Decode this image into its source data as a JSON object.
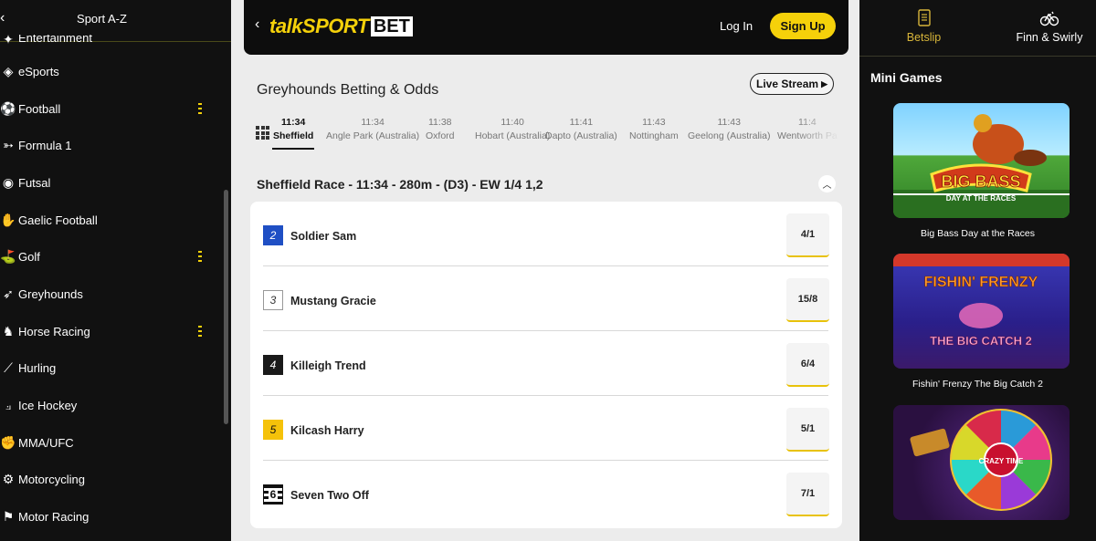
{
  "sidebar": {
    "title": "Sport A-Z",
    "items": [
      {
        "label": "Entertainment",
        "icon": "entertainment-icon",
        "dots": false
      },
      {
        "label": "eSports",
        "icon": "esports-icon",
        "dots": false
      },
      {
        "label": "Football",
        "icon": "football-icon",
        "dots": true
      },
      {
        "label": "Formula 1",
        "icon": "formula1-icon",
        "dots": false
      },
      {
        "label": "Futsal",
        "icon": "futsal-icon",
        "dots": false
      },
      {
        "label": "Gaelic Football",
        "icon": "gaelic-football-icon",
        "dots": false
      },
      {
        "label": "Golf",
        "icon": "golf-icon",
        "dots": true
      },
      {
        "label": "Greyhounds",
        "icon": "greyhound-icon",
        "dots": false
      },
      {
        "label": "Horse Racing",
        "icon": "horse-racing-icon",
        "dots": true
      },
      {
        "label": "Hurling",
        "icon": "hurling-icon",
        "dots": false
      },
      {
        "label": "Ice Hockey",
        "icon": "ice-hockey-icon",
        "dots": false
      },
      {
        "label": "MMA/UFC",
        "icon": "mma-glove-icon",
        "dots": false
      },
      {
        "label": "Motorcycling",
        "icon": "motorcycle-icon",
        "dots": false
      },
      {
        "label": "Motor Racing",
        "icon": "chequered-flag-icon",
        "dots": false
      }
    ]
  },
  "header": {
    "logo_main": "talkSPORT",
    "logo_bet": "BET",
    "login_label": "Log In",
    "signup_label": "Sign Up"
  },
  "main": {
    "page_title": "Greyhounds Betting & Odds",
    "live_stream_label": "Live Stream",
    "race_tabs": [
      {
        "time": "11:34",
        "venue": "Sheffield",
        "active": true
      },
      {
        "time": "11:34",
        "venue": "Angle Park (Australia)",
        "active": false
      },
      {
        "time": "11:38",
        "venue": "Oxford",
        "active": false
      },
      {
        "time": "11:40",
        "venue": "Hobart (Australia)",
        "active": false
      },
      {
        "time": "11:41",
        "venue": "Dapto (Australia)",
        "active": false
      },
      {
        "time": "11:43",
        "venue": "Nottingham",
        "active": false
      },
      {
        "time": "11:43",
        "venue": "Geelong (Australia)",
        "active": false
      },
      {
        "time": "11:4",
        "venue": "Wentworth Pa",
        "active": false
      }
    ],
    "race_heading": "Sheffield Race - 11:34 - 280m - (D3) - EW 1/4 1,2",
    "runners": [
      {
        "trap": "2",
        "name": "Soldier Sam",
        "odds": "4/1"
      },
      {
        "trap": "3",
        "name": "Mustang Gracie",
        "odds": "15/8"
      },
      {
        "trap": "4",
        "name": "Killeigh Trend",
        "odds": "6/4"
      },
      {
        "trap": "5",
        "name": "Kilcash Harry",
        "odds": "5/1"
      },
      {
        "trap": "6",
        "name": "Seven Two Off",
        "odds": "7/1"
      }
    ]
  },
  "right_panel": {
    "tabs": [
      {
        "label": "Betslip",
        "icon": "betslip-icon",
        "active": true
      },
      {
        "label": "Finn & Swirly",
        "icon": "bicycle-icon",
        "active": false
      }
    ],
    "mini_games_title": "Mini Games",
    "games": [
      {
        "label": "Big Bass Day at the Races",
        "logo_text": "BIG BASS",
        "logo_sub": "DAY AT THE RACES"
      },
      {
        "label": "Fishin' Frenzy The Big Catch 2",
        "logo_text": "FISHIN' FRENZY",
        "logo_sub": "THE BIG CATCH 2"
      },
      {
        "label": "",
        "logo_text": "CRAZY TIME",
        "logo_sub": ""
      }
    ]
  },
  "colors": {
    "accent_yellow": "#f5d10a",
    "sidebar_bg": "#111111",
    "main_bg": "#ececec",
    "betslip_active": "#d8b63a",
    "trap2": "#1f4fc4",
    "trap4": "#1a1a1a",
    "trap5": "#f5c20a"
  }
}
